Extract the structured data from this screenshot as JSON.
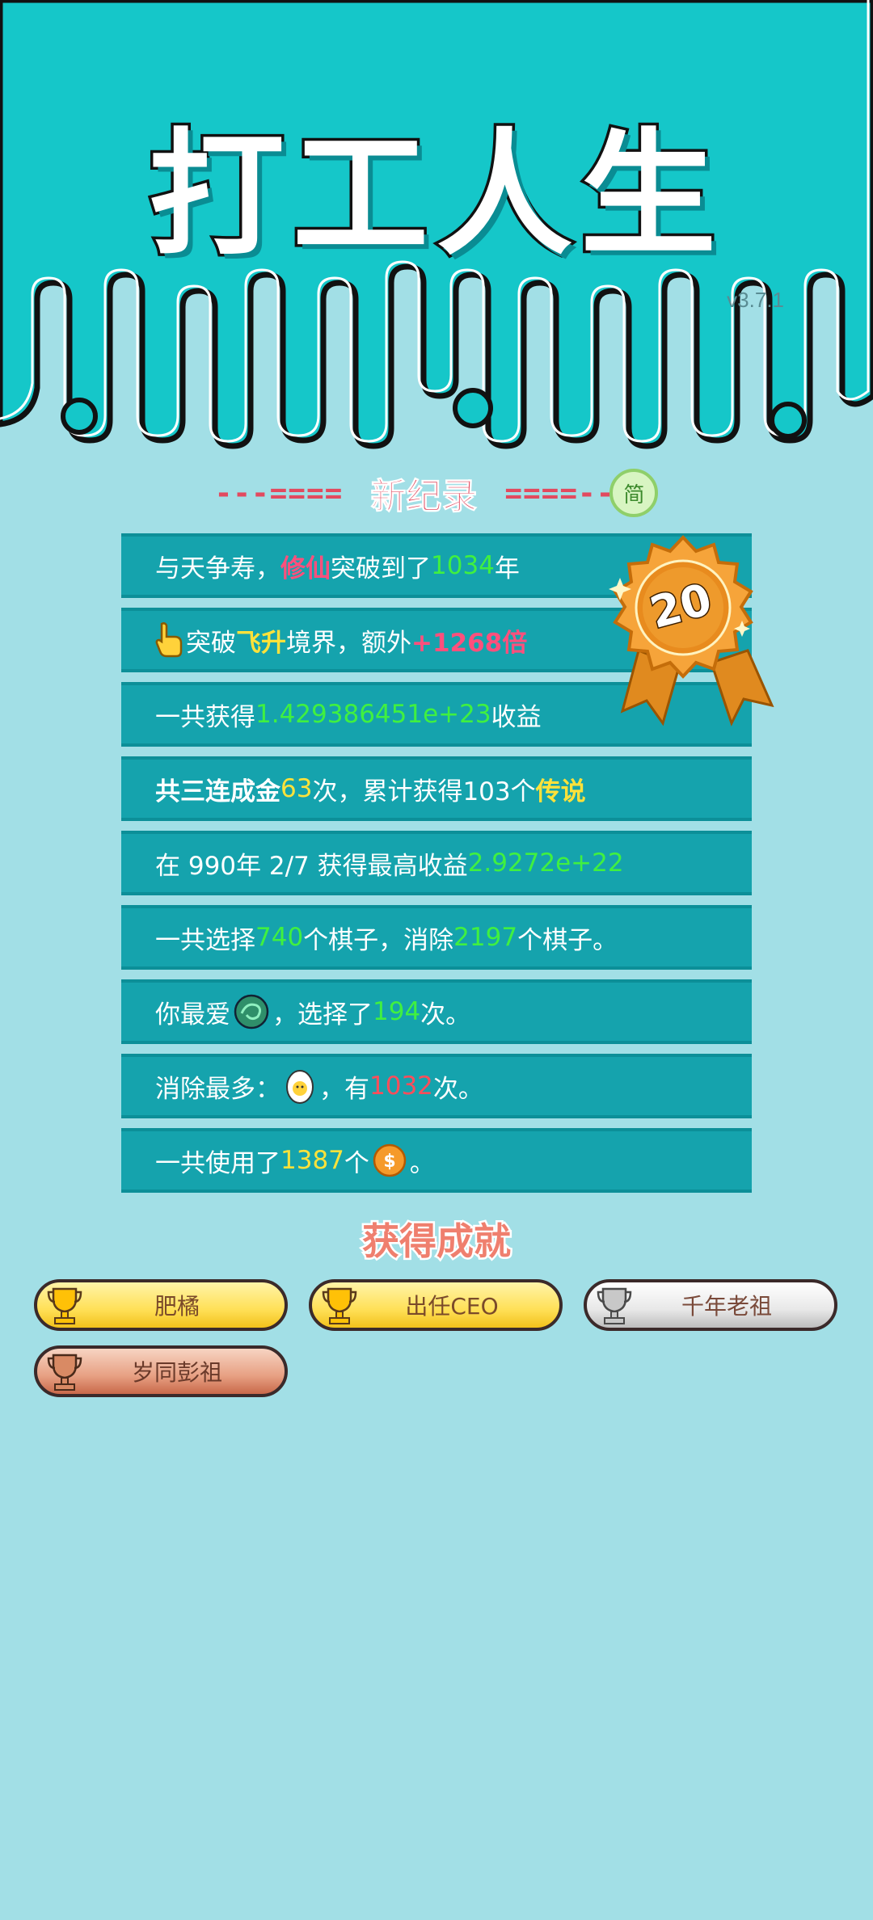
{
  "header": {
    "title": "打工人生",
    "version": "v3.7.1",
    "colors": {
      "teal": "#15c7c9",
      "light": "#a2dfe6"
    }
  },
  "record": {
    "left_dashes": "---====",
    "title": "新纪录",
    "right_dashes": "====--",
    "simplified_badge": "简"
  },
  "medal": {
    "number": "20"
  },
  "rows": [
    {
      "t1": "与天争寿，",
      "t2": "修仙",
      "t3": "突破到了",
      "t4": "1034",
      "t5": "年"
    },
    {
      "t1": "突破",
      "t2": "飞升",
      "t3": "境界，额外",
      "t4": "+1268倍"
    },
    {
      "t1": "一共获得",
      "t2": "1.429386451e+23",
      "t3": "收益"
    },
    {
      "t1": "共三连成金",
      "t2": "63",
      "t3": "次，累计获得103个",
      "t4": "传说"
    },
    {
      "t1": "在 990年 2/7 获得最高收益",
      "t2": "2.9272e+22"
    },
    {
      "t1": "一共选择",
      "t2": "740",
      "t3": "个棋子，消除",
      "t4": "2197",
      "t5": "个棋子。"
    },
    {
      "t1": "你最爱",
      "t2": "，选择了",
      "t3": "194",
      "t4": "次。"
    },
    {
      "t1": "消除最多：",
      "t2": "，有",
      "t3": "1032",
      "t4": "次。"
    },
    {
      "t1": "一共使用了",
      "t2": "1387",
      "t3": "个",
      "t4": "。"
    }
  ],
  "achievements": {
    "title": "获得成就",
    "items": [
      {
        "label": "肥橘",
        "tier": "gold"
      },
      {
        "label": "出任CEO",
        "tier": "gold"
      },
      {
        "label": "千年老祖",
        "tier": "silver"
      },
      {
        "label": "岁同彭祖",
        "tier": "bronze"
      }
    ]
  }
}
